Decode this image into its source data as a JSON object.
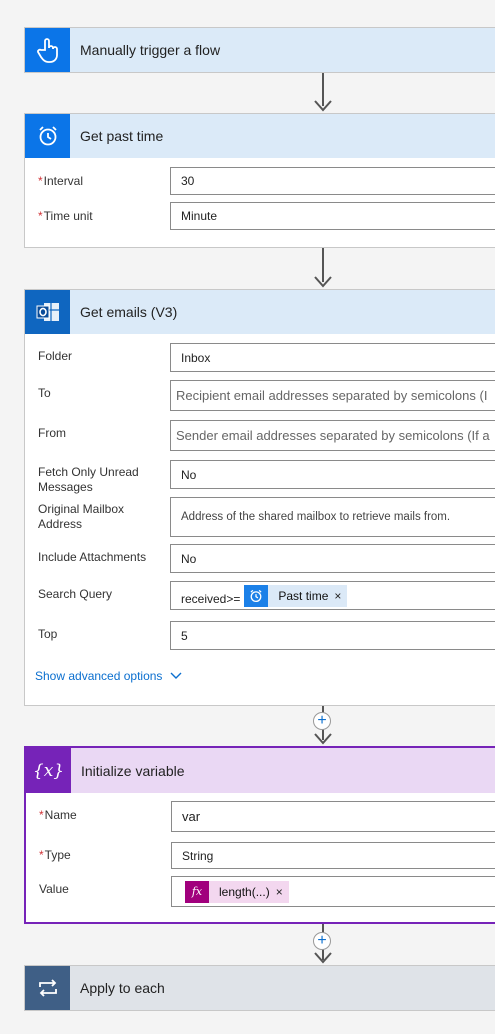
{
  "colors": {
    "trigger_accent": "#0b75e8",
    "trigger_header_bg": "#dbeaf8",
    "outlook_accent": "#0f66c0",
    "variable_accent": "#7623b8",
    "variable_header_bg": "#ead8f4",
    "loop_accent": "#3f5f86",
    "loop_header_bg": "#dfe3e8",
    "link": "#0b6fcf",
    "required": "#d13438"
  },
  "trigger": {
    "title": "Manually trigger a flow",
    "icon": "hand-pointer-icon"
  },
  "get_past_time": {
    "title": "Get past time",
    "icon": "alarm-clock-icon",
    "fields": [
      {
        "label": "Interval",
        "required": true,
        "value": "30"
      },
      {
        "label": "Time unit",
        "required": true,
        "value": "Minute"
      }
    ]
  },
  "get_emails": {
    "title": "Get emails (V3)",
    "icon": "outlook-icon",
    "folder": {
      "label": "Folder",
      "value": "Inbox"
    },
    "to": {
      "label": "To",
      "placeholder": "Recipient email addresses separated by semicolons (I"
    },
    "from": {
      "label": "From",
      "placeholder": "Sender email addresses separated by semicolons (If a"
    },
    "unread": {
      "label_line1": "Fetch Only Unread",
      "label_line2": "Messages",
      "value": "No"
    },
    "mailbox": {
      "label_line1": "Original Mailbox",
      "label_line2": "Address",
      "placeholder": "Address of the shared mailbox to retrieve mails from."
    },
    "attachments": {
      "label": "Include Attachments",
      "value": "No"
    },
    "search": {
      "label": "Search Query",
      "prefix": "received>=",
      "token_label": "Past time",
      "token_icon": "alarm-clock-icon",
      "remove": "×"
    },
    "top": {
      "label": "Top",
      "value": "5"
    },
    "advanced": "Show advanced options"
  },
  "init_variable": {
    "title": "Initialize variable",
    "icon": "variable-icon",
    "icon_text": "{x}",
    "name": {
      "label": "Name",
      "required": true,
      "value": "var"
    },
    "type": {
      "label": "Type",
      "required": true,
      "value": "String"
    },
    "value": {
      "label": "Value",
      "token_label": "length(...)",
      "token_icon": "fx",
      "remove": "×"
    }
  },
  "apply_each": {
    "title": "Apply to each",
    "icon": "loop-icon"
  },
  "connectors": {
    "plus": "+"
  }
}
